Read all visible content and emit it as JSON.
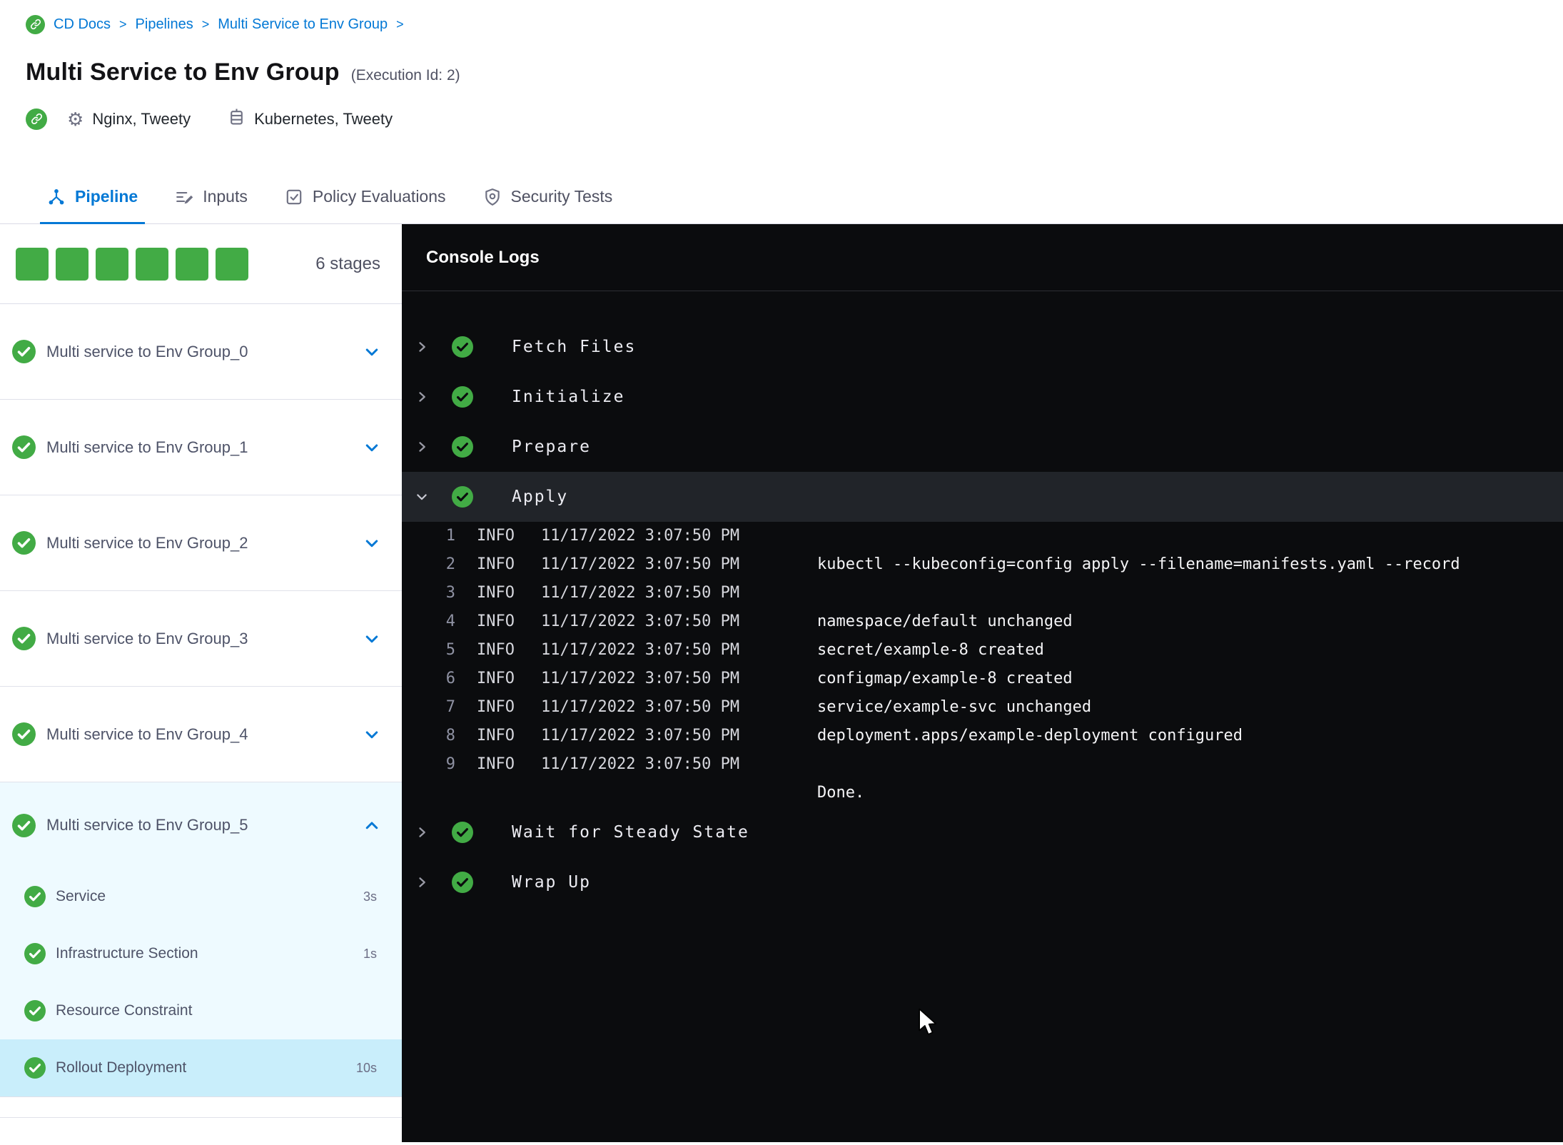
{
  "breadcrumb": {
    "items": [
      "CD Docs",
      "Pipelines",
      "Multi Service to Env Group"
    ],
    "separator": ">"
  },
  "header": {
    "title": "Multi Service to Env Group",
    "execution_id": "(Execution Id: 2)",
    "services": "Nginx, Tweety",
    "infrastructure": "Kubernetes, Tweety"
  },
  "tabs": [
    {
      "label": "Pipeline",
      "active": true
    },
    {
      "label": "Inputs",
      "active": false
    },
    {
      "label": "Policy Evaluations",
      "active": false
    },
    {
      "label": "Security Tests",
      "active": false
    }
  ],
  "stages_panel": {
    "count_label": "6 stages",
    "squares": 6,
    "stages": [
      {
        "label": "Multi service to Env Group_0",
        "status": "success",
        "expanded": false
      },
      {
        "label": "Multi service to Env Group_1",
        "status": "success",
        "expanded": false
      },
      {
        "label": "Multi service to Env Group_2",
        "status": "success",
        "expanded": false
      },
      {
        "label": "Multi service to Env Group_3",
        "status": "success",
        "expanded": false
      },
      {
        "label": "Multi service to Env Group_4",
        "status": "success",
        "expanded": false
      },
      {
        "label": "Multi service to Env Group_5",
        "status": "success",
        "expanded": true,
        "steps": [
          {
            "label": "Service",
            "duration": "3s",
            "status": "success",
            "selected": false
          },
          {
            "label": "Infrastructure Section",
            "duration": "1s",
            "status": "success",
            "selected": false
          },
          {
            "label": "Resource Constraint",
            "duration": "",
            "status": "success",
            "selected": false
          },
          {
            "label": "Rollout Deployment",
            "duration": "10s",
            "status": "success",
            "selected": true
          }
        ]
      }
    ]
  },
  "console": {
    "title": "Console Logs",
    "steps": [
      {
        "label": "Fetch Files",
        "status": "success",
        "expanded": false
      },
      {
        "label": "Initialize",
        "status": "success",
        "expanded": false
      },
      {
        "label": "Prepare",
        "status": "success",
        "expanded": false
      },
      {
        "label": "Apply",
        "status": "success",
        "expanded": true,
        "logs": [
          {
            "num": "1",
            "level": "INFO",
            "time": "11/17/2022 3:07:50 PM",
            "msg": ""
          },
          {
            "num": "2",
            "level": "INFO",
            "time": "11/17/2022 3:07:50 PM",
            "msg": "kubectl --kubeconfig=config apply --filename=manifests.yaml --record"
          },
          {
            "num": "3",
            "level": "INFO",
            "time": "11/17/2022 3:07:50 PM",
            "msg": ""
          },
          {
            "num": "4",
            "level": "INFO",
            "time": "11/17/2022 3:07:50 PM",
            "msg": "namespace/default unchanged"
          },
          {
            "num": "5",
            "level": "INFO",
            "time": "11/17/2022 3:07:50 PM",
            "msg": "secret/example-8 created"
          },
          {
            "num": "6",
            "level": "INFO",
            "time": "11/17/2022 3:07:50 PM",
            "msg": "configmap/example-8 created"
          },
          {
            "num": "7",
            "level": "INFO",
            "time": "11/17/2022 3:07:50 PM",
            "msg": "service/example-svc unchanged"
          },
          {
            "num": "8",
            "level": "INFO",
            "time": "11/17/2022 3:07:50 PM",
            "msg": "deployment.apps/example-deployment configured"
          },
          {
            "num": "9",
            "level": "INFO",
            "time": "11/17/2022 3:07:50 PM",
            "msg": ""
          },
          {
            "num": "",
            "level": "",
            "time": "",
            "msg": "Done."
          }
        ]
      },
      {
        "label": "Wait for Steady State",
        "status": "success",
        "expanded": false
      },
      {
        "label": "Wrap Up",
        "status": "success",
        "expanded": false
      }
    ]
  },
  "colors": {
    "accent_blue": "#0278d5",
    "success_green": "#42ab45",
    "selected_row_blue": "#c9eefb",
    "expanded_block_blue": "#eefaff",
    "console_background": "#0b0c0e"
  }
}
